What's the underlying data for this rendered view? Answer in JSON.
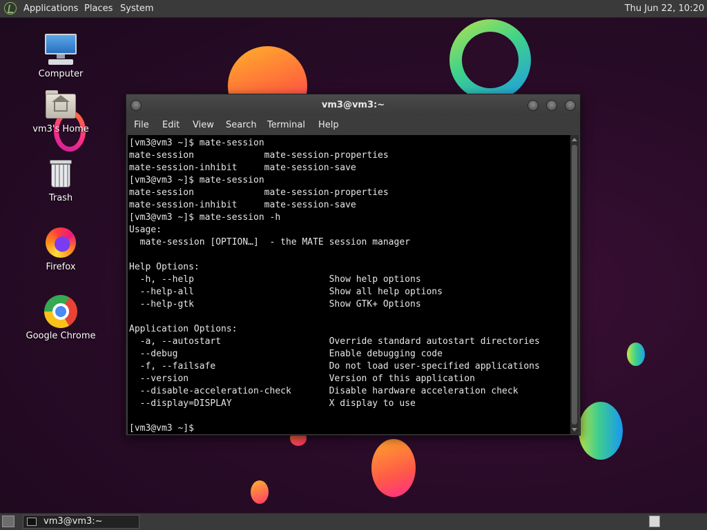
{
  "top_panel": {
    "menus": [
      "Applications",
      "Places",
      "System"
    ],
    "clock": "Thu Jun 22, 10:20"
  },
  "desktop": {
    "icons": [
      {
        "label": "Computer",
        "icon": "computer-icon"
      },
      {
        "label": "vm3's Home",
        "icon": "home-folder-icon"
      },
      {
        "label": "Trash",
        "icon": "trash-icon"
      },
      {
        "label": "Firefox",
        "icon": "firefox-icon"
      },
      {
        "label": "Google Chrome",
        "icon": "chrome-icon"
      }
    ]
  },
  "terminal": {
    "title": "vm3@vm3:~",
    "menu": [
      "File",
      "Edit",
      "View",
      "Search",
      "Terminal",
      "Help"
    ],
    "lines": [
      "[vm3@vm3 ~]$ mate-session",
      "mate-session             mate-session-properties",
      "mate-session-inhibit     mate-session-save",
      "[vm3@vm3 ~]$ mate-session",
      "mate-session             mate-session-properties",
      "mate-session-inhibit     mate-session-save",
      "[vm3@vm3 ~]$ mate-session -h",
      "Usage:",
      "  mate-session [OPTION…]  - the MATE session manager",
      "",
      "Help Options:",
      "  -h, --help                         Show help options",
      "  --help-all                         Show all help options",
      "  --help-gtk                         Show GTK+ Options",
      "",
      "Application Options:",
      "  -a, --autostart                    Override standard autostart directories",
      "  --debug                            Enable debugging code",
      "  -f, --failsafe                     Do not load user-specified applications",
      "  --version                          Version of this application",
      "  --disable-acceleration-check       Disable hardware acceleration check",
      "  --display=DISPLAY                  X display to use",
      "",
      "[vm3@vm3 ~]$ "
    ]
  },
  "bottom_panel": {
    "task_label": "vm3@vm3:~"
  }
}
